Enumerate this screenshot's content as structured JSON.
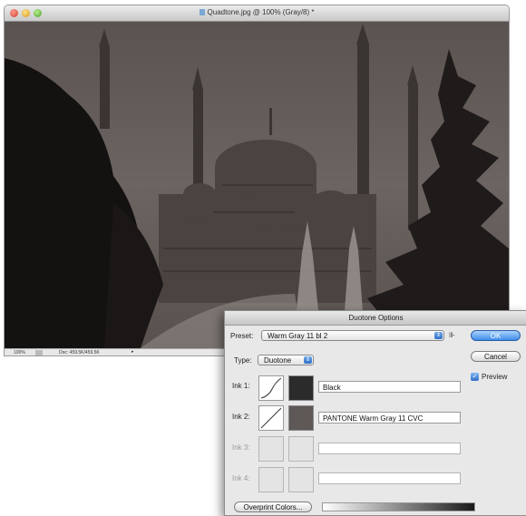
{
  "document": {
    "title": "Quadtone.jpg @ 100% (Gray/8) *",
    "status_zoom": "100%",
    "status_doc": "Doc: 459.5K/459.5K"
  },
  "dialog": {
    "title": "Duotone Options",
    "preset_label": "Preset:",
    "preset_value": "Warm Gray 11 bl 2",
    "type_label": "Type:",
    "type_value": "Duotone",
    "ok_label": "OK",
    "cancel_label": "Cancel",
    "preview_label": "Preview",
    "preview_checked": true,
    "overprint_label": "Overprint Colors...",
    "inks": [
      {
        "label": "Ink 1:",
        "name": "Black",
        "color": "#2b2b2b",
        "enabled": true
      },
      {
        "label": "Ink 2:",
        "name": "PANTONE Warm Gray 11 CVC",
        "color": "#5e5856",
        "enabled": true
      },
      {
        "label": "Ink 3:",
        "name": "",
        "enabled": false
      },
      {
        "label": "Ink 4:",
        "name": "",
        "enabled": false
      }
    ]
  }
}
